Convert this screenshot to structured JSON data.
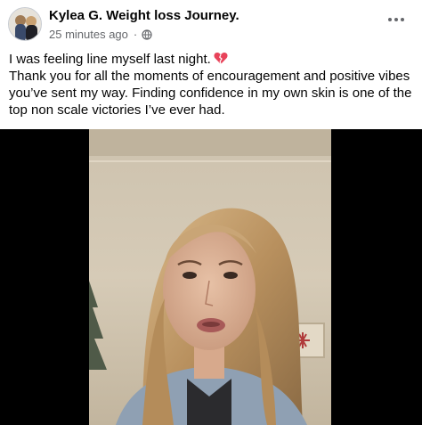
{
  "post": {
    "author": "Kylea G. Weight loss Journey.",
    "timestamp": "25 minutes ago",
    "separator": "·",
    "privacy_icon": "globe-icon",
    "more_icon": "more-options-icon",
    "text_line_1": "I was feeling line myself last night.",
    "text_line_1_emoji": "broken-heart-icon",
    "text_line_2": "Thank you for all the moments of encouragement and positive vibes you’ve sent my way. Finding confidence in my own skin is one of the top non scale victories I’ve ever had."
  },
  "video": {
    "description": "video-frame",
    "background_color": "#000000"
  },
  "colors": {
    "text_primary": "#050505",
    "text_secondary": "#65676b",
    "heart": "#e8435a"
  }
}
